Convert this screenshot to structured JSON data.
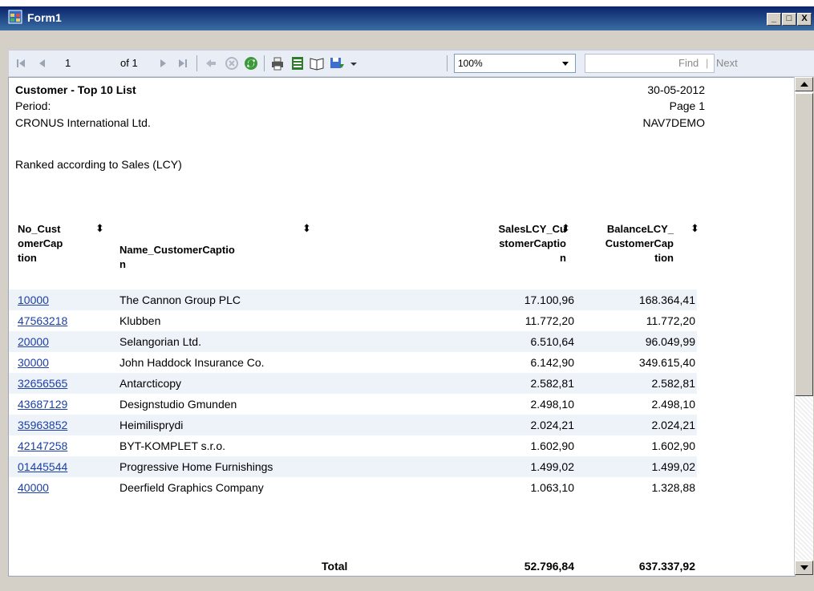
{
  "window": {
    "title": "Form1",
    "minimize": "_",
    "maximize": "□",
    "close": "X"
  },
  "toolbar": {
    "page_current": "1",
    "page_of": "of 1",
    "zoom": "100%",
    "find_label": "Find",
    "next_label": "Next",
    "separator": "|"
  },
  "report": {
    "title": "Customer - Top 10 List",
    "date": "30-05-2012",
    "period_label": "Period:",
    "page": "Page 1",
    "company": "CRONUS International Ltd.",
    "server": "NAV7DEMO",
    "ranked": "Ranked according to Sales (LCY)",
    "columns": {
      "no": [
        "No_Cust",
        "omerCap",
        "tion"
      ],
      "name": [
        "Name_CustomerCaptio",
        "n"
      ],
      "sales": [
        "SalesLCY_Cu",
        "stomerCaptio",
        "n"
      ],
      "balance": [
        "BalanceLCY_",
        "CustomerCap",
        "tion"
      ]
    },
    "sort_glyph": "⬍",
    "rows": [
      {
        "no": "10000",
        "name": "The Cannon Group PLC",
        "sales": "17.100,96",
        "balance": "168.364,41"
      },
      {
        "no": "47563218",
        "name": "Klubben",
        "sales": "11.772,20",
        "balance": "11.772,20"
      },
      {
        "no": "20000",
        "name": "Selangorian Ltd.",
        "sales": "6.510,64",
        "balance": "96.049,99"
      },
      {
        "no": "30000",
        "name": "John Haddock Insurance Co.",
        "sales": "6.142,90",
        "balance": "349.615,40"
      },
      {
        "no": "32656565",
        "name": "Antarcticopy",
        "sales": "2.582,81",
        "balance": "2.582,81"
      },
      {
        "no": "43687129",
        "name": "Designstudio Gmunden",
        "sales": "2.498,10",
        "balance": "2.498,10"
      },
      {
        "no": "35963852",
        "name": "Heimilisprydi",
        "sales": "2.024,21",
        "balance": "2.024,21"
      },
      {
        "no": "42147258",
        "name": "BYT-KOMPLET s.r.o.",
        "sales": "1.602,90",
        "balance": "1.602,90"
      },
      {
        "no": "01445544",
        "name": "Progressive Home Furnishings",
        "sales": "1.499,02",
        "balance": "1.499,02"
      },
      {
        "no": "40000",
        "name": "Deerfield Graphics Company",
        "sales": "1.063,10",
        "balance": "1.328,88"
      }
    ],
    "total_label": "Total",
    "total_sales": "52.796,84",
    "total_balance": "637.337,92"
  },
  "colors": {
    "link": "#1a3fa8",
    "row_alt": "#eef2f9",
    "titlebar": "#0a246a"
  }
}
